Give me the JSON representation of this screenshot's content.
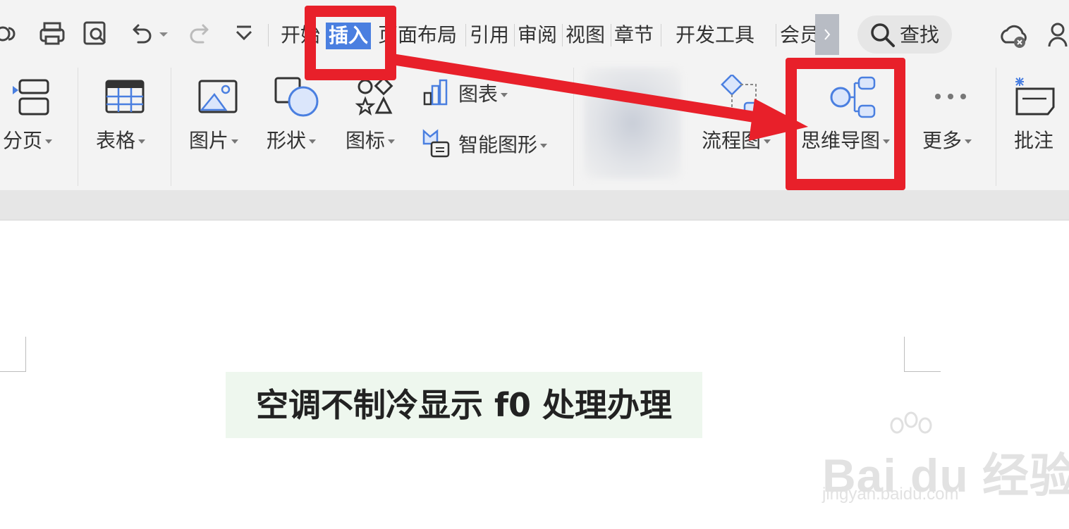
{
  "tabs": [
    {
      "label": "开始",
      "active": false
    },
    {
      "label": "插入",
      "active": true
    },
    {
      "label": "页面布局",
      "active": false
    },
    {
      "label": "引用",
      "active": false
    },
    {
      "label": "审阅",
      "active": false
    },
    {
      "label": "视图",
      "active": false
    },
    {
      "label": "章节",
      "active": false
    },
    {
      "label": "开发工具",
      "active": false
    },
    {
      "label": "会员",
      "active": false
    }
  ],
  "search": {
    "label": "查找"
  },
  "ribbon": {
    "page_break": "分页",
    "table": "表格",
    "picture": "图片",
    "shape": "形状",
    "icon": "图标",
    "chart": "图表",
    "smart_art": "智能图形",
    "flowchart": "流程图",
    "mindmap": "思维导图",
    "more": "更多",
    "comment": "批注"
  },
  "document": {
    "title": "空调不制冷显示 f0 处理办理"
  },
  "watermark": {
    "logo_text": "Bai du 经验",
    "url": "jingyan.baidu.com"
  },
  "colors": {
    "active_tab": "#4a7fe0",
    "annotation": "#e8202a",
    "icon_blue": "#4a7fe0",
    "title_highlight": "#eef7ee"
  },
  "icons": [
    "share-icon",
    "print-icon",
    "print-preview-icon",
    "undo-icon",
    "redo-icon",
    "customize-dropdown-icon",
    "search-icon",
    "cloud-icon",
    "user-icon"
  ]
}
